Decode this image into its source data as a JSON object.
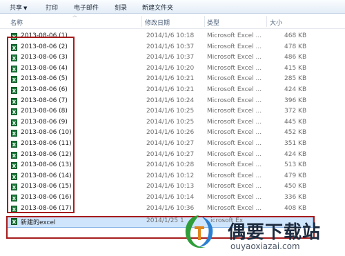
{
  "toolbar": {
    "items": [
      {
        "label": "共享",
        "has_dropdown": true
      },
      {
        "label": "打印",
        "has_dropdown": false
      },
      {
        "label": "电子邮件",
        "has_dropdown": false
      },
      {
        "label": "刻录",
        "has_dropdown": false
      },
      {
        "label": "新建文件夹",
        "has_dropdown": false
      }
    ]
  },
  "columns": {
    "name": "名称",
    "modified": "修改日期",
    "type": "类型",
    "size": "大小"
  },
  "files": [
    {
      "name": "2013-08-06 (1)",
      "modified": "2014/1/6 10:18",
      "type": "Microsoft Excel ...",
      "size": "468 KB"
    },
    {
      "name": "2013-08-06 (2)",
      "modified": "2014/1/6 10:37",
      "type": "Microsoft Excel ...",
      "size": "478 KB"
    },
    {
      "name": "2013-08-06 (3)",
      "modified": "2014/1/6 10:37",
      "type": "Microsoft Excel ...",
      "size": "486 KB"
    },
    {
      "name": "2013-08-06 (4)",
      "modified": "2014/1/6 10:20",
      "type": "Microsoft Excel ...",
      "size": "415 KB"
    },
    {
      "name": "2013-08-06 (5)",
      "modified": "2014/1/6 10:21",
      "type": "Microsoft Excel ...",
      "size": "285 KB"
    },
    {
      "name": "2013-08-06 (6)",
      "modified": "2014/1/6 10:21",
      "type": "Microsoft Excel ...",
      "size": "424 KB"
    },
    {
      "name": "2013-08-06 (7)",
      "modified": "2014/1/6 10:24",
      "type": "Microsoft Excel ...",
      "size": "396 KB"
    },
    {
      "name": "2013-08-06 (8)",
      "modified": "2014/1/6 10:25",
      "type": "Microsoft Excel ...",
      "size": "372 KB"
    },
    {
      "name": "2013-08-06 (9)",
      "modified": "2014/1/6 10:25",
      "type": "Microsoft Excel ...",
      "size": "445 KB"
    },
    {
      "name": "2013-08-06 (10)",
      "modified": "2014/1/6 10:26",
      "type": "Microsoft Excel ...",
      "size": "452 KB"
    },
    {
      "name": "2013-08-06 (11)",
      "modified": "2014/1/6 10:27",
      "type": "Microsoft Excel ...",
      "size": "351 KB"
    },
    {
      "name": "2013-08-06 (12)",
      "modified": "2014/1/6 10:27",
      "type": "Microsoft Excel ...",
      "size": "424 KB"
    },
    {
      "name": "2013-08-06 (13)",
      "modified": "2014/1/6 10:28",
      "type": "Microsoft Excel ...",
      "size": "513 KB"
    },
    {
      "name": "2013-08-06 (14)",
      "modified": "2014/1/6 10:12",
      "type": "Microsoft Excel ...",
      "size": "479 KB"
    },
    {
      "name": "2013-08-06 (15)",
      "modified": "2014/1/6 10:13",
      "type": "Microsoft Excel ...",
      "size": "450 KB"
    },
    {
      "name": "2013-08-06 (16)",
      "modified": "2014/1/6 10:14",
      "type": "Microsoft Excel ...",
      "size": "336 KB"
    },
    {
      "name": "2013-08-06 (17)",
      "modified": "2014/1/6 10:36",
      "type": "Microsoft Excel ...",
      "size": "408 KB"
    }
  ],
  "new_file": {
    "name": "新建的excel",
    "modified": "2014/1/25 1",
    "type": "icrosoft Ex"
  },
  "watermark": {
    "title": "偶要下载站",
    "url": "ouyaoxiazai.com"
  },
  "colors": {
    "highlight_border": "#a61b1b",
    "selection_fill": "#cfe5fb",
    "excel_icon": "#1f7a3c"
  }
}
